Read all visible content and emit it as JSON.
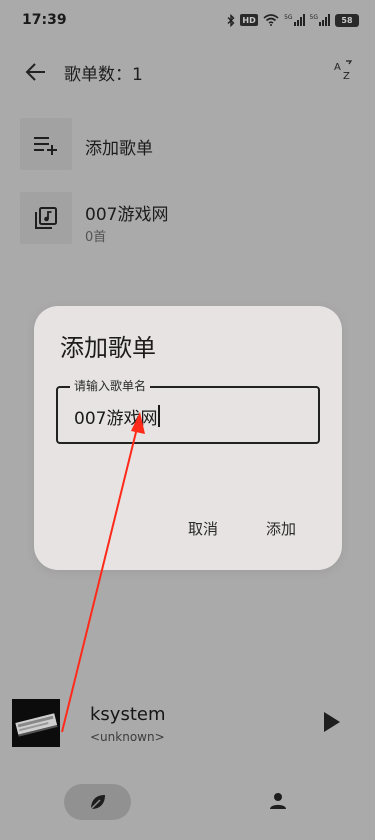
{
  "status_bar": {
    "time": "17:39",
    "hd_badge": "HD",
    "signal1_label": "5G",
    "signal2_label": "5G",
    "battery_level": "58"
  },
  "header": {
    "title": "歌单数：1",
    "back_icon": "arrow-left-icon",
    "sort_icon": "sort-az-icon"
  },
  "list": {
    "add_item": {
      "label": "添加歌单",
      "icon": "playlist-add-icon"
    },
    "playlists": [
      {
        "title": "007游戏网",
        "subtitle": "0首",
        "icon": "music-library-icon"
      }
    ]
  },
  "dialog": {
    "title": "添加歌单",
    "input_label": "请输入歌单名",
    "input_value": "007游戏网",
    "cancel_label": "取消",
    "confirm_label": "添加"
  },
  "now_playing": {
    "title": "ksystem",
    "artist": "<unknown>",
    "play_icon": "play-icon"
  },
  "bottom_nav": {
    "items": [
      {
        "icon": "leaf-icon",
        "active": true
      },
      {
        "icon": "person-icon",
        "active": false
      }
    ]
  },
  "colors": {
    "background": "#abaaaa",
    "dialog_bg": "#e6e3e2",
    "annotation_arrow": "#ff2a1a"
  }
}
